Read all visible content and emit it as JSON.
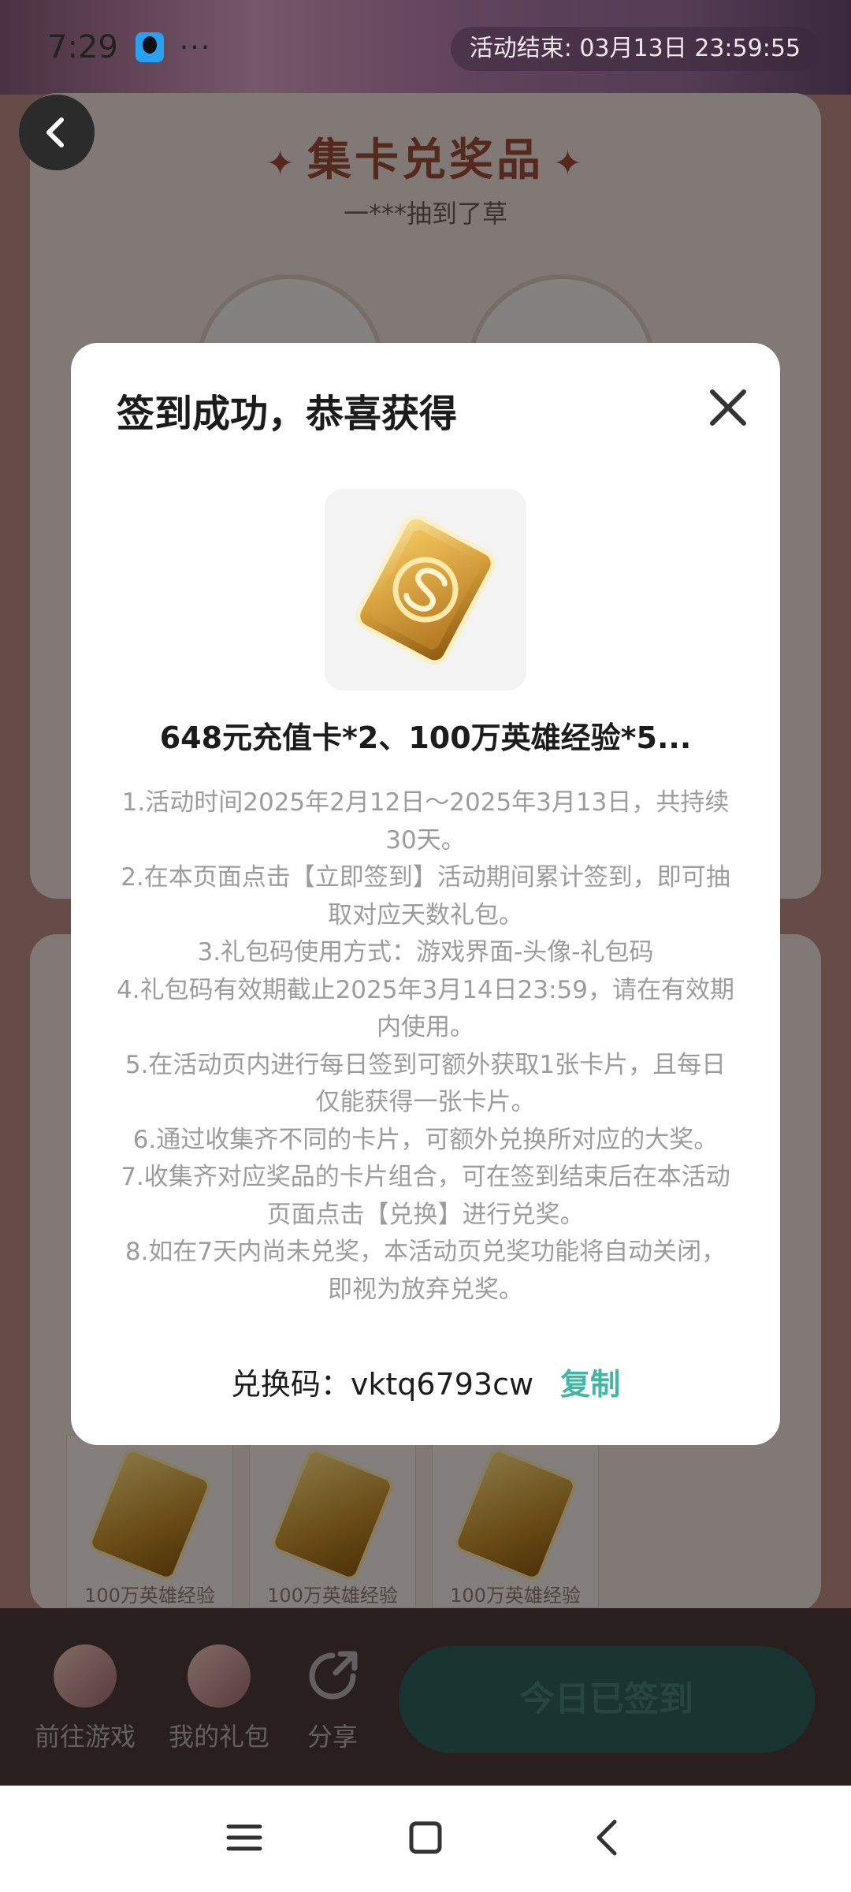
{
  "status_bar": {
    "time": "7:29",
    "dots": "···",
    "activity_end": "活动结束: 03月13日 23:59:55"
  },
  "background": {
    "section_title": "集卡兑奖品",
    "ticker": "一***抽到了草",
    "mini_card_label": "100万英雄经验"
  },
  "bottom_dock": {
    "items": [
      {
        "label": "前往游戏"
      },
      {
        "label": "我的礼包"
      },
      {
        "label": "分享"
      }
    ],
    "signed_button": "今日已签到"
  },
  "modal": {
    "title": "签到成功，恭喜获得",
    "prize_name": "648元充值卡*2、100万英雄经验*5...",
    "rules": [
      "1.活动时间2025年2月12日～2025年3月13日，共持续30天。",
      "2.在本页面点击【立即签到】活动期间累计签到，即可抽取对应天数礼包。",
      "3.礼包码使用方式：游戏界面-头像-礼包码",
      "4.礼包码有效期截止2025年3月14日23:59，请在有效期内使用。",
      "5.在活动页内进行每日签到可额外获取1张卡片，且每日仅能获得一张卡片。",
      "6.通过收集齐不同的卡片，可额外兑换所对应的大奖。",
      "7.收集齐对应奖品的卡片组合，可在签到结束后在本活动页面点击【兑换】进行兑奖。",
      "8.如在7天内尚未兑奖，本活动页兑奖功能将自动关闭，即视为放弃兑奖。"
    ],
    "code_label": "兑换码：",
    "code_value": "vktq6793cw",
    "copy_label": "复制"
  },
  "colors": {
    "accent": "#3fb7a4",
    "title_brown": "#9b4b38",
    "dim_overlay": "rgba(0,0,0,0.45)"
  }
}
